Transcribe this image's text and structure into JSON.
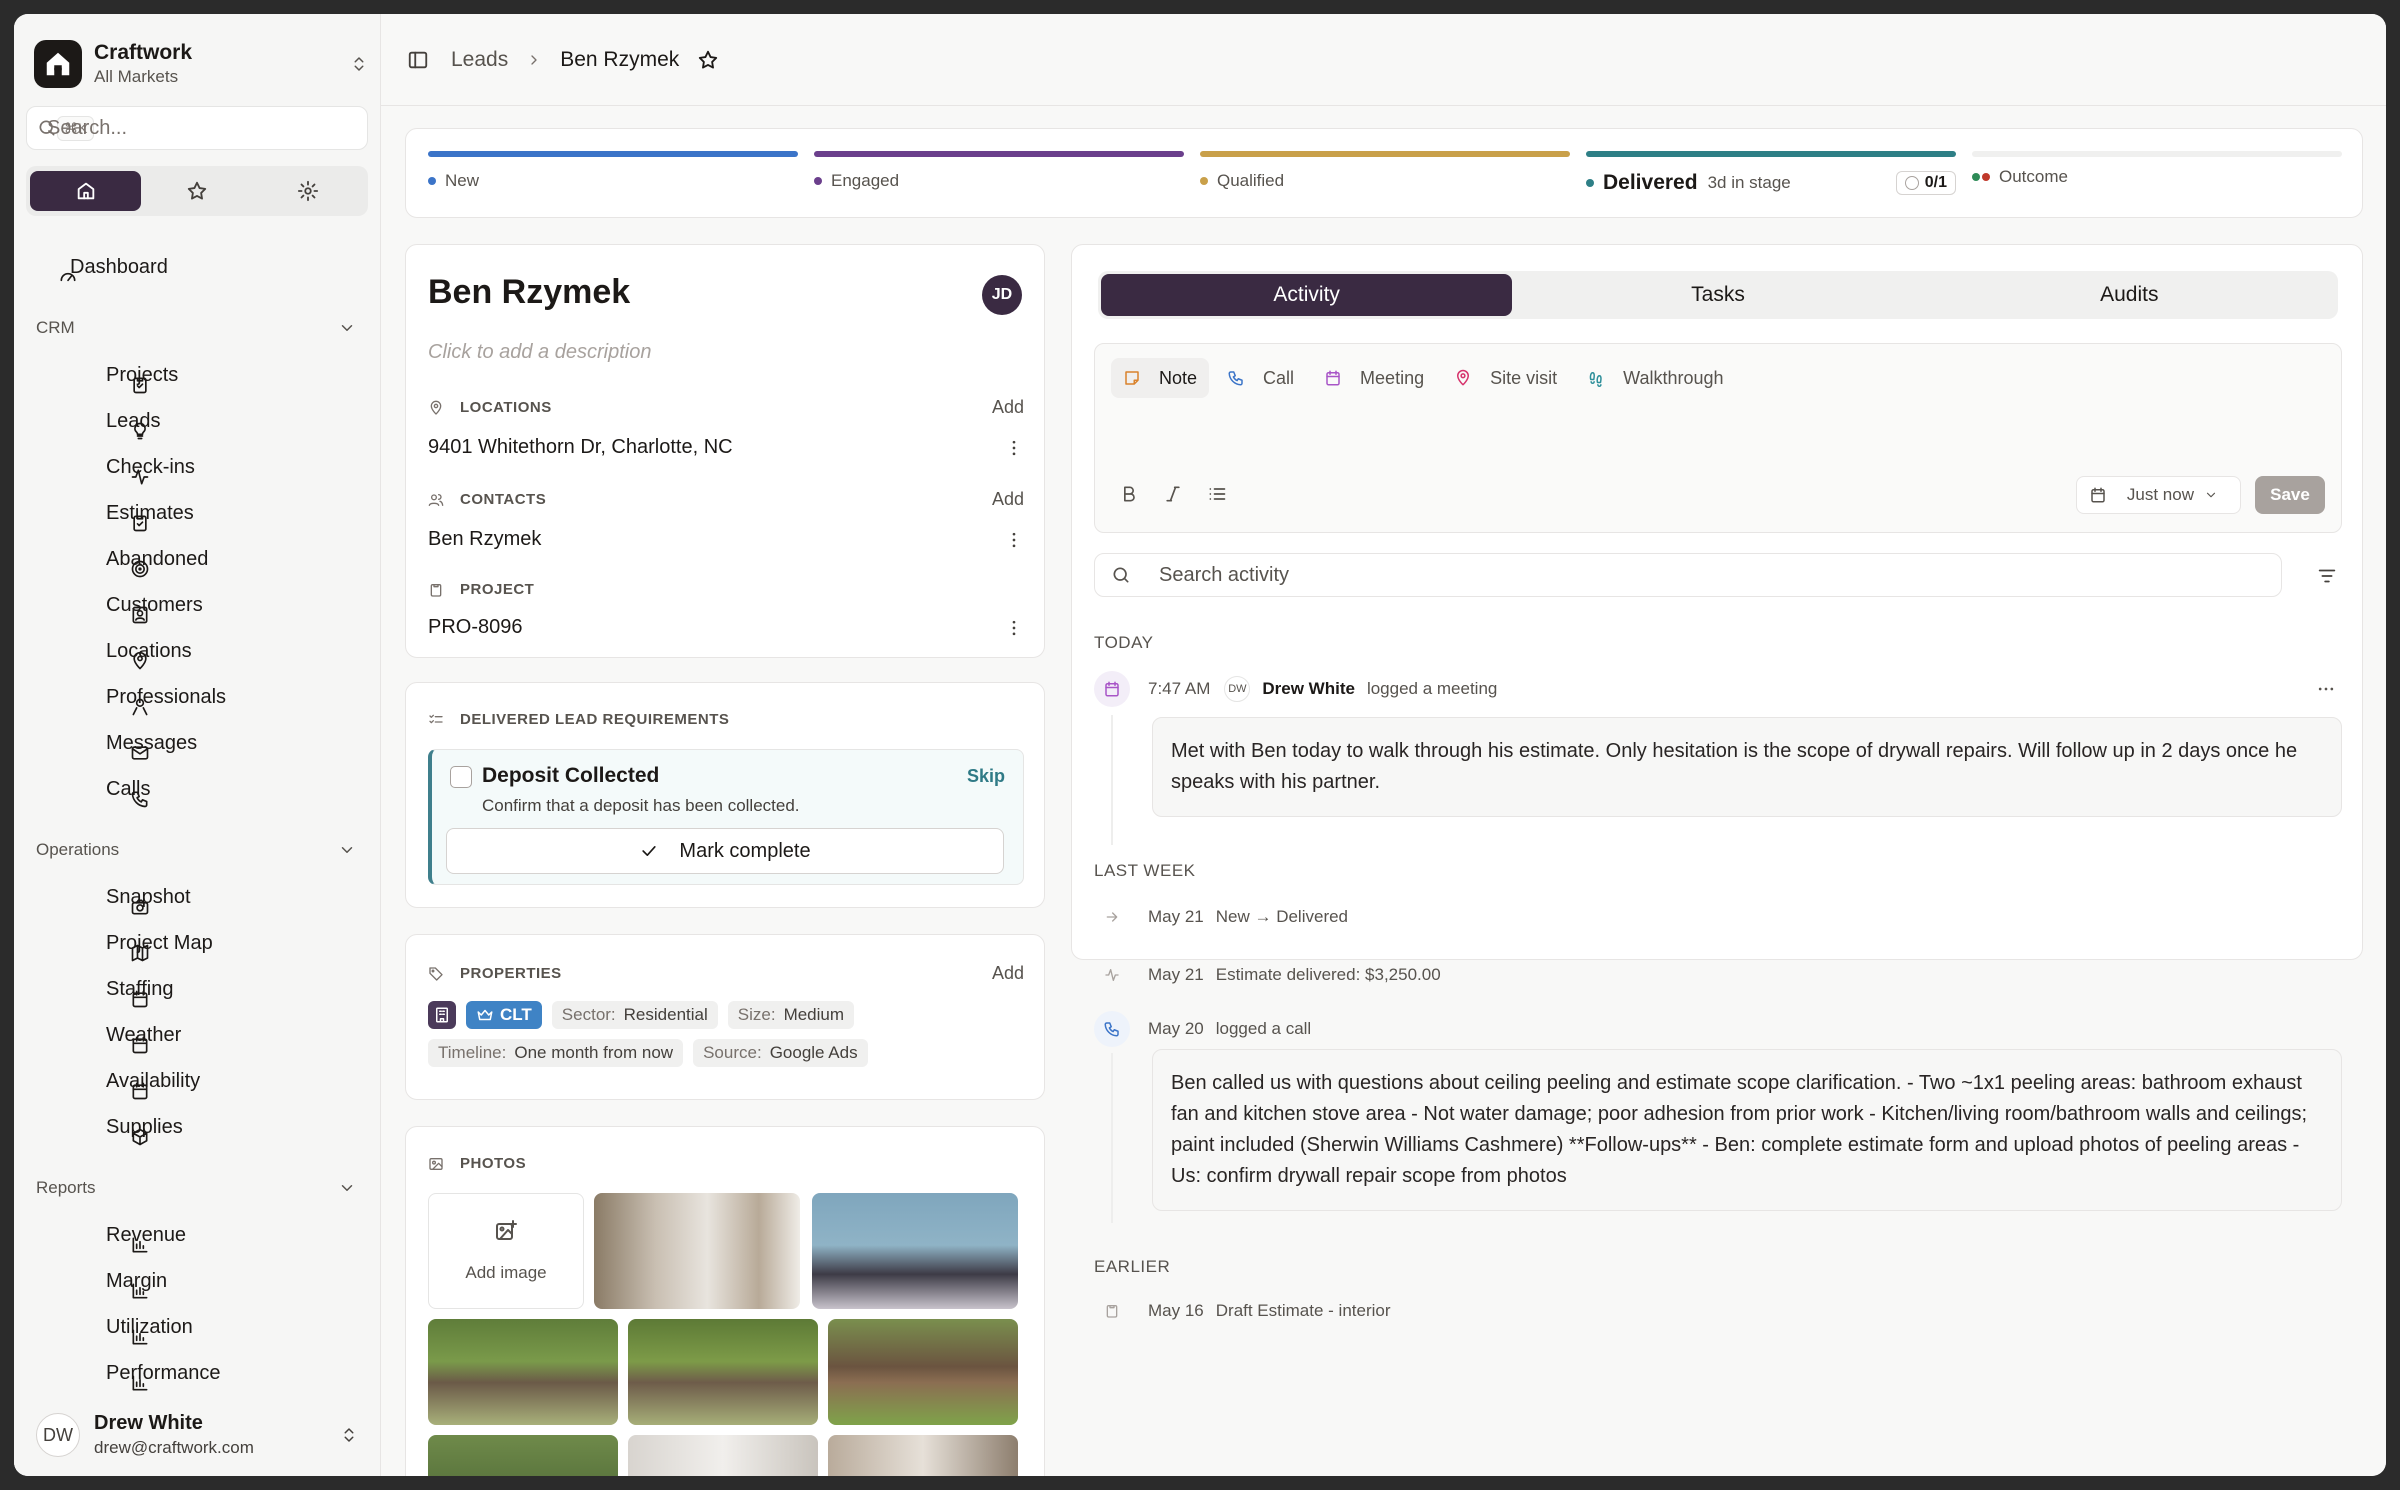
{
  "brand": {
    "name": "Craftwork",
    "sub": "All Markets"
  },
  "search": {
    "placeholder": "Search...",
    "shortcut": "⌘K"
  },
  "nav": {
    "dashboard": "Dashboard",
    "crm_label": "CRM",
    "crm": [
      "Projects",
      "Leads",
      "Check-ins",
      "Estimates",
      "Abandoned",
      "Customers",
      "Locations",
      "Professionals",
      "Messages",
      "Calls"
    ],
    "operations_label": "Operations",
    "operations": [
      "Snapshot",
      "Project Map",
      "Staffing",
      "Weather",
      "Availability",
      "Supplies"
    ],
    "reports_label": "Reports",
    "reports": [
      "Revenue",
      "Margin",
      "Utilization",
      "Performance"
    ]
  },
  "user": {
    "initials": "DW",
    "name": "Drew White",
    "email": "drew@craftwork.com"
  },
  "breadcrumb": {
    "parent": "Leads",
    "current": "Ben Rzymek"
  },
  "pipeline": {
    "stages": [
      {
        "label": "New",
        "color": "#3b74c8"
      },
      {
        "label": "Engaged",
        "color": "#6b3f8c"
      },
      {
        "label": "Qualified",
        "color": "#c9a04a"
      },
      {
        "label": "Delivered",
        "color": "#2e7f86",
        "meta": "3d in stage",
        "count": "0/1"
      },
      {
        "label": "Outcome",
        "color": "#e5e5e4"
      }
    ]
  },
  "lead": {
    "name": "Ben Rzymek",
    "owner_initials": "JD",
    "description_placeholder": "Click to add a description",
    "locations_label": "LOCATIONS",
    "location": "9401 Whitethorn Dr, Charlotte, NC",
    "contacts_label": "CONTACTS",
    "contact": "Ben Rzymek",
    "project_label": "PROJECT",
    "project": "PRO-8096",
    "add_label": "Add"
  },
  "requirements": {
    "title": "DELIVERED LEAD REQUIREMENTS",
    "item": "Deposit Collected",
    "skip": "Skip",
    "desc": "Confirm that a deposit has been collected.",
    "action": "Mark complete"
  },
  "properties": {
    "title": "PROPERTIES",
    "add": "Add",
    "market": "CLT",
    "sector_k": "Sector:",
    "sector_v": "Residential",
    "size_k": "Size:",
    "size_v": "Medium",
    "timeline_k": "Timeline:",
    "timeline_v": "One month from now",
    "source_k": "Source:",
    "source_v": "Google Ads"
  },
  "photos": {
    "title": "PHOTOS",
    "add": "Add image"
  },
  "tabs": [
    "Activity",
    "Tasks",
    "Audits"
  ],
  "composer": {
    "types": [
      "Note",
      "Call",
      "Meeting",
      "Site visit",
      "Walkthrough"
    ],
    "when": "Just now",
    "save": "Save"
  },
  "activity": {
    "search_placeholder": "Search activity",
    "today": "TODAY",
    "e1_time": "7:47 AM",
    "e1_initials": "DW",
    "e1_who": "Drew White",
    "e1_action": "logged a meeting",
    "e1_body": "Met with Ben today to walk through his estimate. Only hesitation is the scope of drywall repairs. Will follow up in 2 days once he speaks with his partner.",
    "last_week": "LAST WEEK",
    "e2_date": "May 21",
    "e2_text": "New → Delivered",
    "e3_date": "May 21",
    "e3_text": "Estimate delivered: $3,250.00",
    "e4_date": "May 20",
    "e4_text": "logged a call",
    "e4_body": "Ben called us with questions about ceiling peeling and estimate scope clarification. - Two ~1x1 peeling areas: bathroom exhaust fan and kitchen stove area - Not water damage; poor adhesion from prior work - Kitchen/living room/bathroom walls and ceilings; paint included (Sherwin Williams Cashmere) **Follow-ups** - Ben: complete estimate form and upload photos of peeling areas - Us: confirm drywall repair scope from photos",
    "earlier": "EARLIER",
    "e5_date": "May 16",
    "e5_text": "Draft Estimate - interior"
  }
}
